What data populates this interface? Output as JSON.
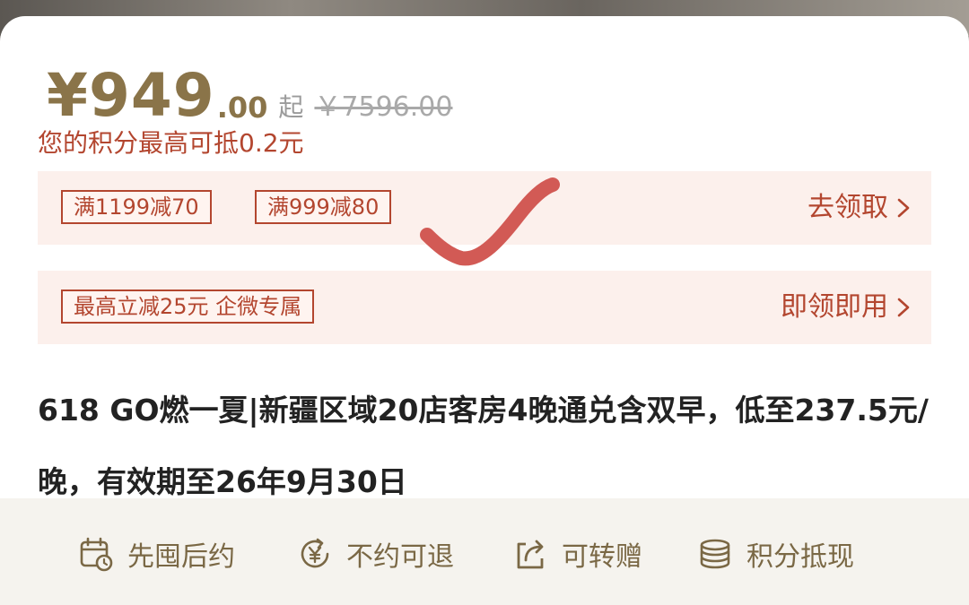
{
  "price": {
    "currency": "¥",
    "integer": "949",
    "decimal": ".00",
    "suffix": "起",
    "original": "￥7596.00"
  },
  "points_note": "您的积分最高可抵0.2元",
  "coupons": {
    "row1": {
      "chips": [
        "满1199减70",
        "满999减80"
      ],
      "action_label": "去领取"
    },
    "row2": {
      "chips": [
        "最高立减25元 企微专属"
      ],
      "action_label": "即领即用"
    }
  },
  "title": "618 GO燃一夏|新疆区域20店客房4晚通兑含双早，低至237.5元/晚，有效期至26年9月30日",
  "features": [
    {
      "icon": "calendar-clock-icon",
      "label": "先囤后约"
    },
    {
      "icon": "refund-yen-icon",
      "label": "不约可退"
    },
    {
      "icon": "share-gift-icon",
      "label": "可转赠"
    },
    {
      "icon": "coins-icon",
      "label": "积分抵现"
    }
  ],
  "colors": {
    "price_gold": "#8a7449",
    "accent_red": "#b3462f",
    "coupon_bg": "#fcf0ec",
    "feature_bg": "#f5f3ee",
    "feature_text": "#7a6845",
    "checkmark": "#d25a55"
  }
}
